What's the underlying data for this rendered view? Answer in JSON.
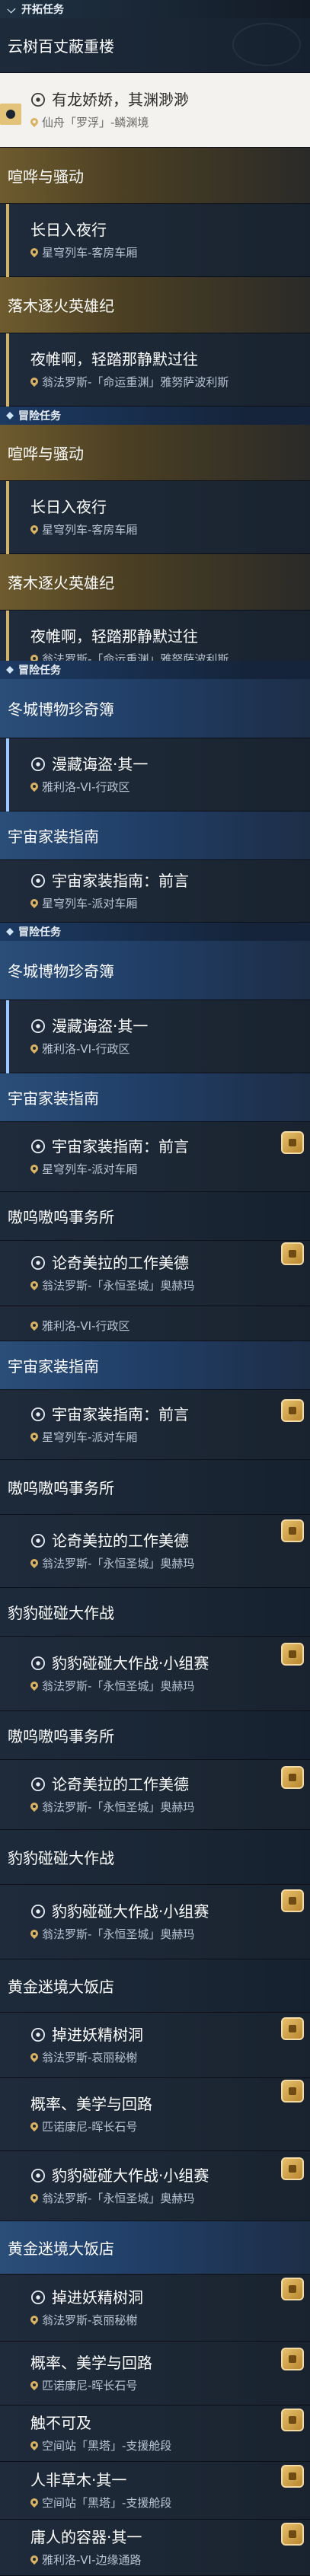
{
  "sections": {
    "s1": "开拓任务",
    "s2": "冒险任务",
    "s3": "冒险任务",
    "s4": "冒险任务"
  },
  "rows": {
    "r1": "云树百丈蔽重楼",
    "r2_title": "有龙娇娇，其渊渺渺",
    "r2_sub": "仙舟「罗浮」-鳞渊境",
    "r3": "喧哗与骚动",
    "r4_title": "长日入夜行",
    "r4_sub": "星穹列车-客房车厢",
    "r5": "落木逐火英雄纪",
    "r6_title": "夜帷啊，轻踏那静默过往",
    "r6_sub": "翁法罗斯-「命运重渊」雅努萨波利斯",
    "r7": "喧哗与骚动",
    "r8_title": "长日入夜行",
    "r8_sub": "星穹列车-客房车厢",
    "r9": "落木逐火英雄纪",
    "r10_title": "夜帷啊，轻踏那静默过往",
    "r10_sub": "翁法罗斯-「命运重渊」雅努萨波利斯",
    "r11": "冬城博物珍奇簿",
    "r12_title": "漫藏诲盗·其一",
    "r12_sub": "雅利洛-VI-行政区",
    "r13": "宇宙家装指南",
    "r14_title": "宇宙家装指南：前言",
    "r14_sub": "星穹列车-派对车厢",
    "r15": "冬城博物珍奇簿",
    "r16_title": "漫藏诲盗·其一",
    "r16_sub": "雅利洛-VI-行政区",
    "r17": "宇宙家装指南",
    "r18_title": "宇宙家装指南：前言",
    "r18_sub": "星穹列车-派对车厢",
    "r19": "嗷呜嗷呜事务所",
    "r20_title": "论奇美拉的工作美德",
    "r20_sub": "翁法罗斯-「永恒圣城」奥赫玛",
    "r21_sub": "雅利洛-VI-行政区",
    "r22": "宇宙家装指南",
    "r23_title": "宇宙家装指南：前言",
    "r23_sub": "星穹列车-派对车厢",
    "r24": "嗷呜嗷呜事务所",
    "r25_title": "论奇美拉的工作美德",
    "r25_sub": "翁法罗斯-「永恒圣城」奥赫玛",
    "r26": "豹豹碰碰大作战",
    "r27_title": "豹豹碰碰大作战·小组赛",
    "r27_sub": "翁法罗斯-「永恒圣城」奥赫玛",
    "r28": "嗷呜嗷呜事务所",
    "r29_title": "论奇美拉的工作美德",
    "r29_sub": "翁法罗斯-「永恒圣城」奥赫玛",
    "r30": "豹豹碰碰大作战",
    "r31_title": "豹豹碰碰大作战·小组赛",
    "r31_sub": "翁法罗斯-「永恒圣城」奥赫玛",
    "r32": "黄金迷境大饭店",
    "r33_title": "掉进妖精树洞",
    "r33_sub": "翁法罗斯-哀丽秘榭",
    "r34_title": "概率、美学与回路",
    "r34_sub": "匹诺康尼-晖长石号",
    "r35_title": "豹豹碰碰大作战·小组赛",
    "r35_sub": "翁法罗斯-「永恒圣城」奥赫玛",
    "r36": "黄金迷境大饭店",
    "r37_title": "掉进妖精树洞",
    "r37_sub": "翁法罗斯-哀丽秘榭",
    "r38_title": "概率、美学与回路",
    "r38_sub": "匹诺康尼-晖长石号",
    "r39_title": "触不可及",
    "r39_sub": "空间站「黑塔」-支援舱段",
    "r40_title": "人非草木·其一",
    "r40_sub": "空间站「黑塔」-支援舱段",
    "r41_title": "庸人的容器·其一",
    "r41_sub": "雅利洛-VI-边缘通路"
  },
  "colors": {
    "gold": "#d2b26a",
    "blue": "#9cc7ff",
    "bg": "#0f1520"
  }
}
